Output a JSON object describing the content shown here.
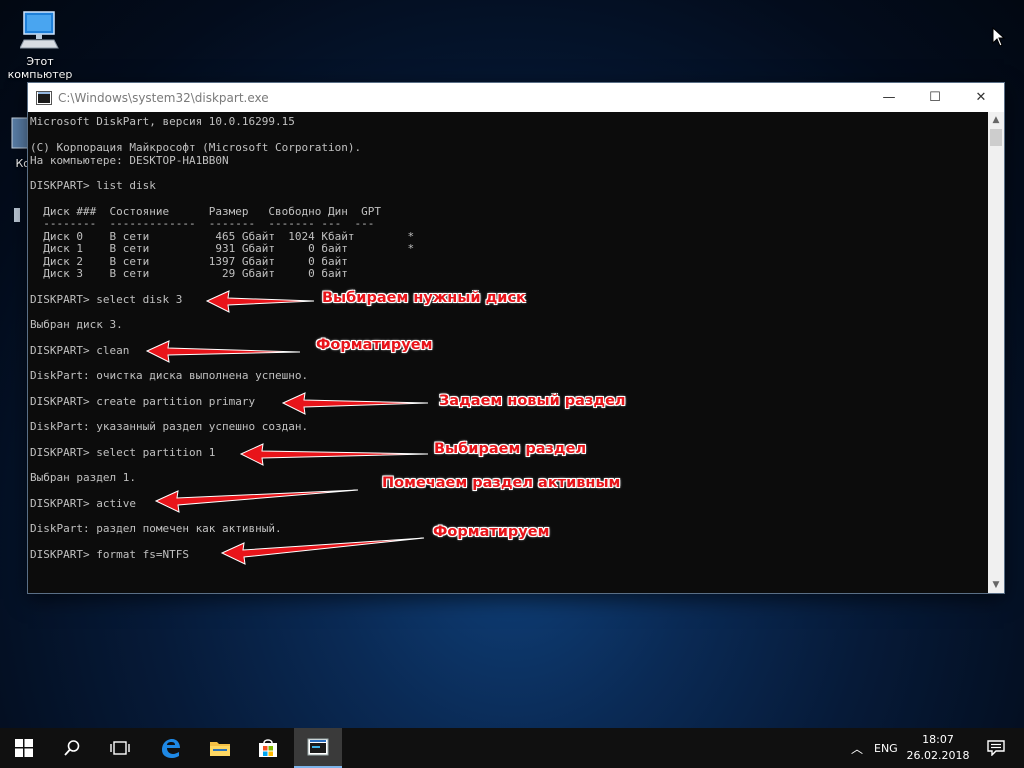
{
  "desktop": {
    "icons": [
      {
        "label_line1": "Этот",
        "label_line2": "компьютер",
        "icon": "computer-icon"
      },
      {
        "label_line1": "Ко",
        "icon": "recycle-bin-icon"
      }
    ]
  },
  "window": {
    "title": "C:\\Windows\\system32\\diskpart.exe",
    "minimize": "—",
    "maximize": "☐",
    "close": "✕"
  },
  "console": {
    "lines": [
      "Microsoft DiskPart, версия 10.0.16299.15",
      "",
      "(C) Корпорация Майкрософт (Microsoft Corporation).",
      "На компьютере: DESKTOP-HA1BB0N",
      "",
      "DISKPART> list disk",
      "",
      "  Диск ###  Состояние      Размер   Свободно Дин  GPT",
      "  --------  -------------  -------  ------- ---  ---",
      "  Диск 0    В сети          465 Gбайт  1024 Kбайт        *",
      "  Диск 1    В сети          931 Gбайт     0 байт         *",
      "  Диск 2    В сети         1397 Gбайт     0 байт",
      "  Диск 3    В сети           29 Gбайт     0 байт",
      "",
      "DISKPART> select disk 3",
      "",
      "Выбран диск 3.",
      "",
      "DISKPART> clean",
      "",
      "DiskPart: очистка диска выполнена успешно.",
      "",
      "DISKPART> create partition primary",
      "",
      "DiskPart: указанный раздел успешно создан.",
      "",
      "DISKPART> select partition 1",
      "",
      "Выбран раздел 1.",
      "",
      "DISKPART> active",
      "",
      "DiskPart: раздел помечен как активный.",
      "",
      "DISKPART> format fs=NTFS"
    ]
  },
  "annotations": [
    "Выбираем нужный диск",
    "Форматируем",
    "Задаем новый раздел",
    "Выбираем раздел",
    "Помечаем раздел активным",
    "Форматируем"
  ],
  "annotation_color": "#e8141a",
  "taskbar": {
    "items": [
      "start-icon",
      "search-icon",
      "task-view-icon",
      "edge-icon",
      "file-explorer-icon",
      "store-icon",
      "diskpart-icon"
    ],
    "language": "ENG",
    "time": "18:07",
    "date": "26.02.2018"
  }
}
